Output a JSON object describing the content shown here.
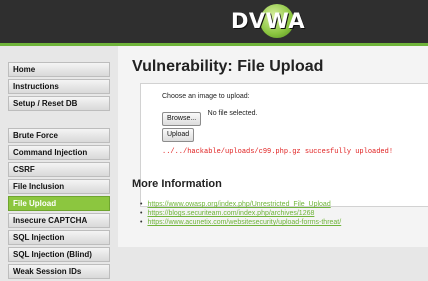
{
  "header": {
    "logo_text": "DVWA",
    "colors": {
      "bar": "#2f2f2f",
      "accent": "#8cc63f"
    }
  },
  "sidebar": {
    "groups": [
      [
        "Home",
        "Instructions",
        "Setup / Reset DB"
      ],
      [
        "Brute Force",
        "Command Injection",
        "CSRF",
        "File Inclusion",
        "File Upload",
        "Insecure CAPTCHA",
        "SQL Injection",
        "SQL Injection (Blind)",
        "Weak Session IDs"
      ]
    ],
    "selected": "File Upload"
  },
  "main": {
    "title": "Vulnerability: File Upload",
    "upload": {
      "label": "Choose an image to upload:",
      "browse_label": "Browse...",
      "file_status": "No file selected.",
      "upload_label": "Upload",
      "message": "../../hackable/uploads/c99.php.gz succesfully uploaded!",
      "message_color": "#e02020"
    },
    "more_info_title": "More Information",
    "links": [
      "https://www.owasp.org/index.php/Unrestricted_File_Upload",
      "https://blogs.securiteam.com/index.php/archives/1268",
      "https://www.acunetix.com/websitesecurity/upload-forms-threat/"
    ],
    "link_color": "#6fb43a"
  }
}
